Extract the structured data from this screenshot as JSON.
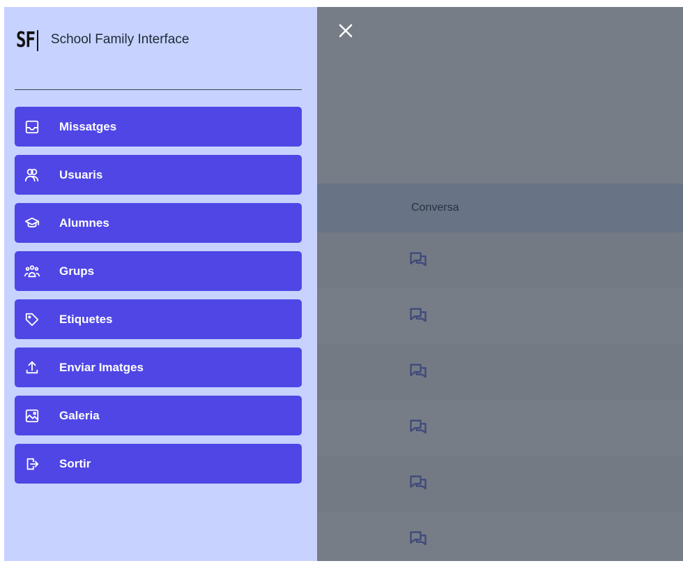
{
  "app": {
    "logo_text": "SF",
    "title": "School Family Interface"
  },
  "sidebar": {
    "items": [
      {
        "label": "Missatges",
        "icon": "inbox-icon"
      },
      {
        "label": "Usuaris",
        "icon": "users-icon"
      },
      {
        "label": "Alumnes",
        "icon": "graduation-cap-icon"
      },
      {
        "label": "Grups",
        "icon": "user-group-icon"
      },
      {
        "label": "Etiquetes",
        "icon": "tag-icon"
      },
      {
        "label": "Enviar Imatges",
        "icon": "upload-icon"
      },
      {
        "label": "Galeria",
        "icon": "image-icon"
      },
      {
        "label": "Sortir",
        "icon": "logout-icon"
      }
    ]
  },
  "overlay": {
    "close_icon": "close-icon"
  },
  "table": {
    "column_header": "Conversa",
    "row_icon": "chat-bubbles-icon"
  },
  "colors": {
    "sidebar_bg": "#c7d2fe",
    "nav_button": "#4f46e5",
    "overlay": "#767d87"
  }
}
